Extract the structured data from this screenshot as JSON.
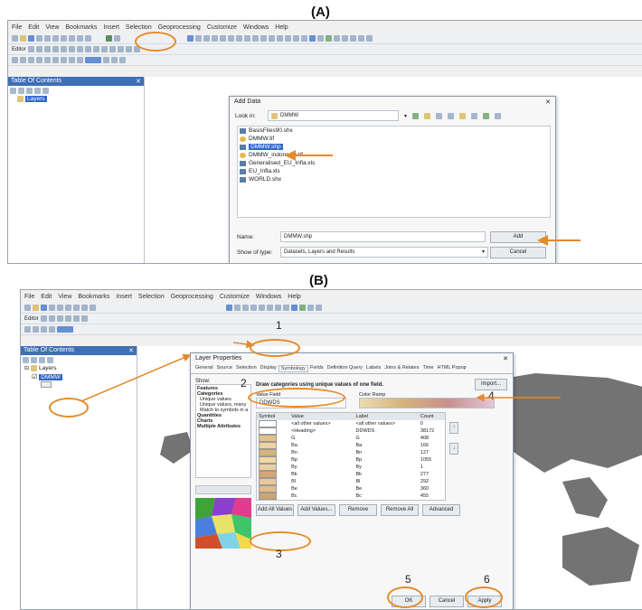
{
  "labels": {
    "a": "(A)",
    "b": "(B)"
  },
  "menu": [
    "File",
    "Edit",
    "View",
    "Bookmarks",
    "Insert",
    "Selection",
    "Geoprocessing",
    "Customize",
    "Windows",
    "Help"
  ],
  "editor_label": "Editor",
  "toc": {
    "title": "Table Of Contents",
    "layers": "Layers",
    "layer_b": "DMMW"
  },
  "add_data": {
    "title": "Add Data",
    "look_in_label": "Look in:",
    "look_in_value": "DMMW",
    "files": [
      "BasisFiles90.shx",
      "DMMW.tif",
      "DMMW.shp",
      "DMMW_indonesia.tif",
      "Generalised_EU_Infla.xls",
      "EU_Infla.xls",
      "WORLD.shx"
    ],
    "name_label": "Name:",
    "name_value": "DMMW.shp",
    "show_label": "Show of type:",
    "show_value": "Datasets, Layers and Results",
    "add_button": "Add",
    "cancel_button": "Cancel"
  },
  "layer_props": {
    "title": "Layer Properties",
    "tabs": [
      "General",
      "Source",
      "Selection",
      "Display",
      "Symbology",
      "Fields",
      "Definition Query",
      "Labels",
      "Joins & Relates",
      "Time",
      "HTML Popup"
    ],
    "show_label": "Show:",
    "show_items": [
      "Features",
      "Categories",
      "Unique values",
      "Unique values, many",
      "Match to symbols in a",
      "Quantities",
      "Charts",
      "Multiple Attributes"
    ],
    "heading": "Draw categories using unique values of one field.",
    "import_button": "Import...",
    "value_field_label": "Value Field",
    "value_field": "DDWDS",
    "color_ramp_label": "Color Ramp",
    "columns": [
      "Symbol",
      "Value",
      "Label",
      "Count"
    ],
    "rows": [
      {
        "value": "<all other values>",
        "label": "<all other values>",
        "count": "0"
      },
      {
        "value": "<Heading>",
        "label": "DDWDS",
        "count": "38172"
      },
      {
        "value": "G",
        "label": "G",
        "count": "408"
      },
      {
        "value": "Ba",
        "label": "Ba",
        "count": "166"
      },
      {
        "value": "Bn",
        "label": "Bn",
        "count": "127"
      },
      {
        "value": "Bp",
        "label": "Bp",
        "count": "1055"
      },
      {
        "value": "By",
        "label": "By",
        "count": "1"
      },
      {
        "value": "Bk",
        "label": "Bk",
        "count": "277"
      },
      {
        "value": "Bl",
        "label": "Bl",
        "count": "292"
      },
      {
        "value": "Be",
        "label": "Be",
        "count": "360"
      },
      {
        "value": "Bc",
        "label": "Bc",
        "count": "455"
      }
    ],
    "row_colors": [
      "#ffffff",
      "#ffffff",
      "#e6c089",
      "#eed3a6",
      "#d9b37b",
      "#f0d9a2",
      "#ead0a2",
      "#d7a56f",
      "#e9c99a",
      "#e2bd86",
      "#cfa574"
    ],
    "buttons": [
      "Add All Values",
      "Add Values...",
      "Remove",
      "Remove All",
      "Advanced"
    ],
    "ok": "OK",
    "cancel": "Cancel",
    "apply": "Apply"
  },
  "annotations": [
    "1",
    "2",
    "3",
    "4",
    "5",
    "6"
  ],
  "colors": {
    "accent": "#e38b2a",
    "selection": "#2f69c8"
  }
}
